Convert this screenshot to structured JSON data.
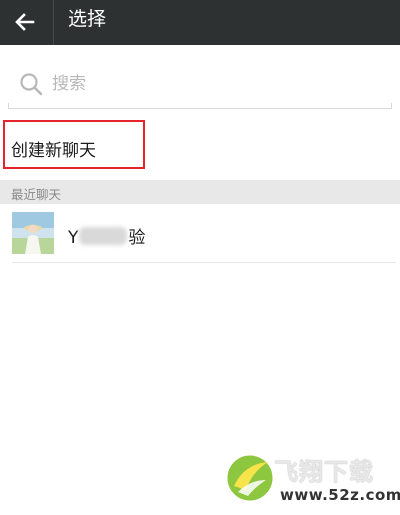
{
  "header": {
    "title": "选择"
  },
  "search": {
    "placeholder": "搜索",
    "value": ""
  },
  "new_chat": {
    "label": "创建新聊天"
  },
  "recent": {
    "section_title": "最近聊天",
    "contacts": [
      {
        "name_start": "Y",
        "name_end": "验",
        "avatar": "landscape-photo"
      }
    ]
  },
  "watermark": {
    "brand": "飞翔下载",
    "url": "www.52z.com"
  },
  "icons": {
    "back": "arrow-left-icon",
    "search": "search-icon"
  },
  "colors": {
    "topbar": "#2e3132",
    "highlight": "#e5242b",
    "section_bg": "#e8e8e8"
  }
}
